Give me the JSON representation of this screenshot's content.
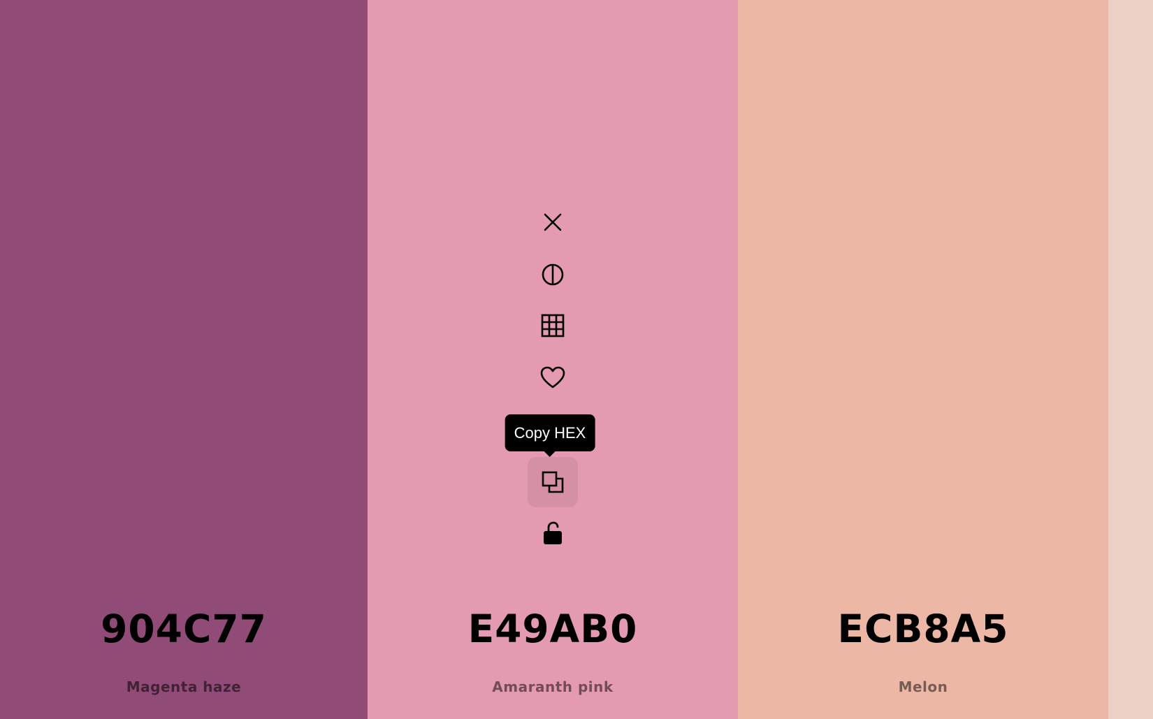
{
  "colors": [
    {
      "hex": "904C77",
      "name": "Magenta haze",
      "bg": "#904C77"
    },
    {
      "hex": "E49AB0",
      "name": "Amaranth pink",
      "bg": "#E49AB0"
    },
    {
      "hex": "ECB8A5",
      "name": "Melon",
      "bg": "#ECB8A5"
    },
    {
      "hex": "",
      "name": "",
      "bg": "#ECD0C5"
    }
  ],
  "toolbar": {
    "tooltip": "Copy HEX",
    "icons": [
      "close-icon",
      "contrast-icon",
      "grid-icon",
      "heart-icon",
      "copy-icon",
      "unlock-icon"
    ]
  }
}
